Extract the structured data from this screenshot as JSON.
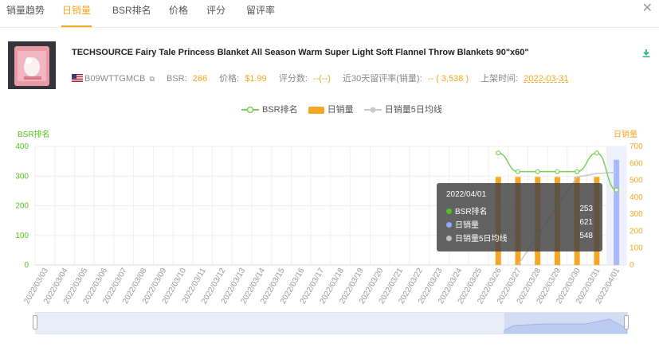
{
  "tabs": [
    {
      "label": "销量趋势"
    },
    {
      "label": "日销量"
    },
    {
      "label": "BSR排名"
    },
    {
      "label": "价格"
    },
    {
      "label": "评分"
    },
    {
      "label": "留评率"
    }
  ],
  "product": {
    "title": "TECHSOURCE Fairy Tale Princess Blanket All Season Warm Super Light Soft Flannel Throw Blankets 90\"x60\"",
    "asin": "B09WTTGMCB",
    "bsr_label": "BSR:",
    "bsr_value": "266",
    "price_label": "价格:",
    "price_value": "$1.99",
    "reviews_label": "评分数:",
    "reviews_value": "--(--)",
    "retention_label": "近30天留评率(销量):",
    "retention_value": "-- ( 3,538 )",
    "listed_label": "上架时间:",
    "listed_value": "2022-03-31"
  },
  "legend": {
    "bsr": "BSR排名",
    "sales": "日销量",
    "ma": "日销量5日均线"
  },
  "axis": {
    "left_title": "BSR排名",
    "right_title": "日销量"
  },
  "tooltip": {
    "date": "2022/04/01",
    "rows": [
      {
        "label": "BSR排名",
        "value": "253",
        "color": "#52c41a"
      },
      {
        "label": "日销量",
        "value": "621",
        "color": "#8fa8ff"
      },
      {
        "label": "日销量5日均线",
        "value": "548",
        "color": "#c0c0c0"
      }
    ]
  },
  "colors": {
    "accent": "#f5a623",
    "bsr_line": "#7cd05a",
    "sales_bar": "#f5a623",
    "sales_bar_highlight": "#a8b8ff",
    "ma_line": "#c8c8c8"
  },
  "chart_data": {
    "type": "bar",
    "categories": [
      "2022/03/03",
      "2022/03/04",
      "2022/03/05",
      "2022/03/06",
      "2022/03/07",
      "2022/03/08",
      "2022/03/09",
      "2022/03/10",
      "2022/03/11",
      "2022/03/12",
      "2022/03/13",
      "2022/03/14",
      "2022/03/15",
      "2022/03/16",
      "2022/03/17",
      "2022/03/18",
      "2022/03/19",
      "2022/03/20",
      "2022/03/21",
      "2022/03/22",
      "2022/03/23",
      "2022/03/24",
      "2022/03/25",
      "2022/03/26",
      "2022/03/27",
      "2022/03/28",
      "2022/03/29",
      "2022/03/30",
      "2022/03/31",
      "2022/04/01"
    ],
    "y_left": {
      "title": "BSR排名",
      "ticks": [
        0,
        100,
        200,
        300,
        400
      ],
      "ylim": [
        0,
        400
      ]
    },
    "y_right": {
      "title": "日销量",
      "ticks": [
        0,
        100,
        200,
        300,
        400,
        500,
        600,
        700
      ],
      "ylim": [
        0,
        700
      ]
    },
    "series": [
      {
        "name": "BSR排名",
        "type": "line",
        "axis": "left",
        "values": [
          null,
          null,
          null,
          null,
          null,
          null,
          null,
          null,
          null,
          null,
          null,
          null,
          null,
          null,
          null,
          null,
          null,
          null,
          null,
          null,
          null,
          null,
          null,
          378,
          315,
          315,
          315,
          315,
          378,
          253
        ]
      },
      {
        "name": "日销量",
        "type": "bar",
        "axis": "right",
        "values": [
          null,
          null,
          null,
          null,
          null,
          null,
          null,
          null,
          null,
          null,
          null,
          null,
          null,
          null,
          null,
          null,
          null,
          null,
          null,
          null,
          null,
          null,
          null,
          520,
          520,
          520,
          520,
          520,
          520,
          621
        ]
      },
      {
        "name": "日销量5日均线",
        "type": "line",
        "axis": "right",
        "values": [
          null,
          null,
          null,
          null,
          null,
          null,
          null,
          null,
          null,
          null,
          null,
          null,
          null,
          null,
          null,
          null,
          null,
          null,
          null,
          null,
          null,
          null,
          null,
          null,
          null,
          null,
          null,
          520,
          540,
          548
        ]
      }
    ],
    "highlighted_category": "2022/04/01",
    "grid": true
  }
}
